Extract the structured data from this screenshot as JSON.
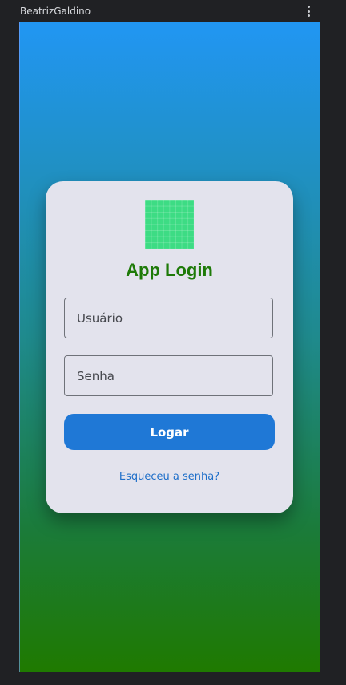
{
  "window": {
    "title": "BeatrizGaldino",
    "menu_icon": "more-vertical-icon"
  },
  "colors": {
    "gradient_top": "#2196f3",
    "gradient_bottom": "#1f7a00",
    "card_background": "#e3e3ed",
    "title_color": "#1e7a08",
    "button_color": "#1f78d6",
    "link_color": "#1f6fc9",
    "logo_color": "#3ddc84"
  },
  "login": {
    "logo_icon": "app-logo-icon",
    "title": "App Login",
    "username_placeholder": "Usuário",
    "password_placeholder": "Senha",
    "submit_label": "Logar",
    "forgot_link": "Esqueceu a senha?"
  }
}
